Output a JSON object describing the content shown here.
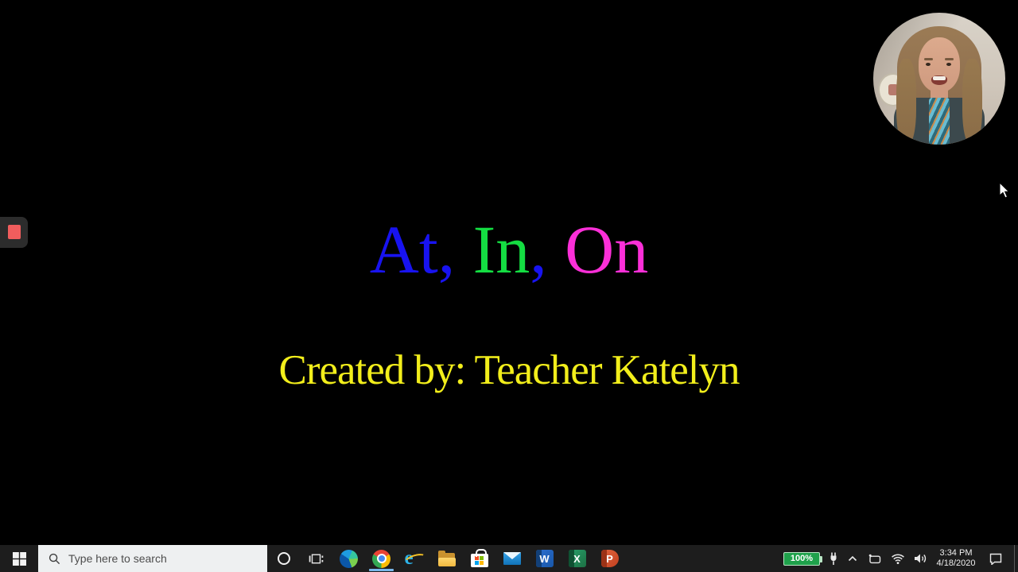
{
  "slide": {
    "title_segments": [
      {
        "text": "At,",
        "color": "#1813f0"
      },
      {
        "text": "In",
        "color": "#14dd42"
      },
      {
        "text": ",",
        "color": "#1813f0"
      },
      {
        "text": "On",
        "color": "#fb2fd8"
      }
    ],
    "subtitle": {
      "text": "Created by: Teacher Katelyn",
      "color": "#f2ee1b"
    }
  },
  "webcam": {
    "description": "presenter video thumbnail"
  },
  "annotation_toolbar": {
    "stop_square_color": "#f15d5d",
    "panel_color": "#2c2c2c"
  },
  "taskbar": {
    "search_placeholder": "Type here to search",
    "app_icon_names": [
      "cortana",
      "task-view",
      "edge",
      "chrome",
      "internet-explorer",
      "file-explorer",
      "microsoft-store",
      "mail",
      "word",
      "excel",
      "powerpoint"
    ],
    "active_app": "chrome",
    "active_underline_color": "#79b8eb",
    "apps": {
      "word": {
        "letter": "W"
      },
      "excel": {
        "letter": "X"
      },
      "powerpoint": {
        "letter": "P"
      }
    },
    "tray": {
      "icon_names": [
        "battery",
        "power-plug",
        "chevron-up",
        "camera",
        "wifi",
        "volume",
        "clock",
        "action-center",
        "show-desktop"
      ],
      "battery_percent": "100%",
      "battery_color": "#1fa14b",
      "time": "3:34 PM",
      "date": "4/18/2020"
    }
  }
}
